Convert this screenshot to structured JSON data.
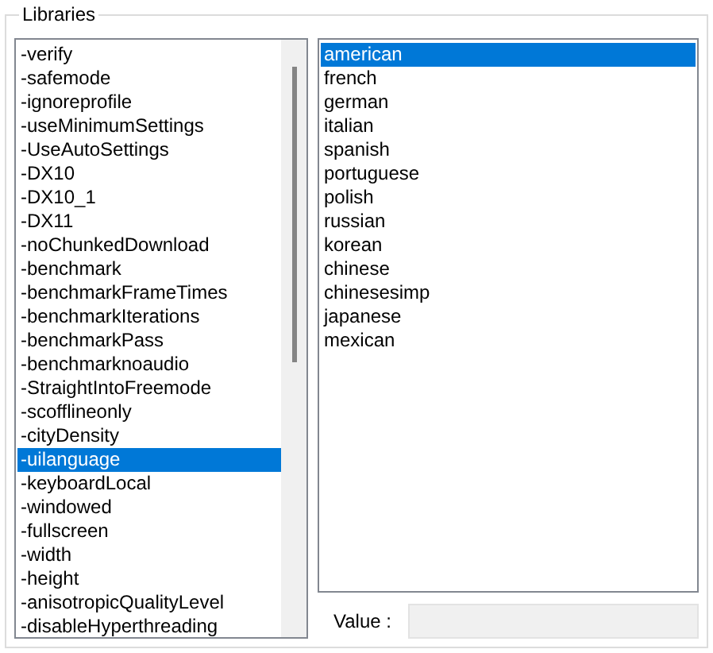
{
  "group": {
    "title": "Libraries"
  },
  "arguments": [
    {
      "label": "-verify",
      "selected": false
    },
    {
      "label": "-safemode",
      "selected": false
    },
    {
      "label": "-ignoreprofile",
      "selected": false
    },
    {
      "label": "-useMinimumSettings",
      "selected": false
    },
    {
      "label": "-UseAutoSettings",
      "selected": false
    },
    {
      "label": "-DX10",
      "selected": false
    },
    {
      "label": "-DX10_1",
      "selected": false
    },
    {
      "label": "-DX11",
      "selected": false
    },
    {
      "label": "-noChunkedDownload",
      "selected": false
    },
    {
      "label": "-benchmark",
      "selected": false
    },
    {
      "label": "-benchmarkFrameTimes",
      "selected": false
    },
    {
      "label": "-benchmarkIterations",
      "selected": false
    },
    {
      "label": "-benchmarkPass",
      "selected": false
    },
    {
      "label": "-benchmarknoaudio",
      "selected": false
    },
    {
      "label": "-StraightIntoFreemode",
      "selected": false
    },
    {
      "label": "-scofflineonly",
      "selected": false
    },
    {
      "label": "-cityDensity",
      "selected": false
    },
    {
      "label": "-uilanguage",
      "selected": true
    },
    {
      "label": "-keyboardLocal",
      "selected": false
    },
    {
      "label": "-windowed",
      "selected": false
    },
    {
      "label": "-fullscreen",
      "selected": false
    },
    {
      "label": "-width",
      "selected": false
    },
    {
      "label": "-height",
      "selected": false
    },
    {
      "label": "-anisotropicQualityLevel",
      "selected": false
    },
    {
      "label": "-disableHyperthreading",
      "selected": false
    }
  ],
  "options": [
    {
      "label": "american",
      "selected": true
    },
    {
      "label": "french",
      "selected": false
    },
    {
      "label": "german",
      "selected": false
    },
    {
      "label": "italian",
      "selected": false
    },
    {
      "label": "spanish",
      "selected": false
    },
    {
      "label": "portuguese",
      "selected": false
    },
    {
      "label": "polish",
      "selected": false
    },
    {
      "label": "russian",
      "selected": false
    },
    {
      "label": "korean",
      "selected": false
    },
    {
      "label": "chinese",
      "selected": false
    },
    {
      "label": "chinesesimp",
      "selected": false
    },
    {
      "label": "japanese",
      "selected": false
    },
    {
      "label": "mexican",
      "selected": false
    }
  ],
  "value_field": {
    "label": "Value :"
  }
}
